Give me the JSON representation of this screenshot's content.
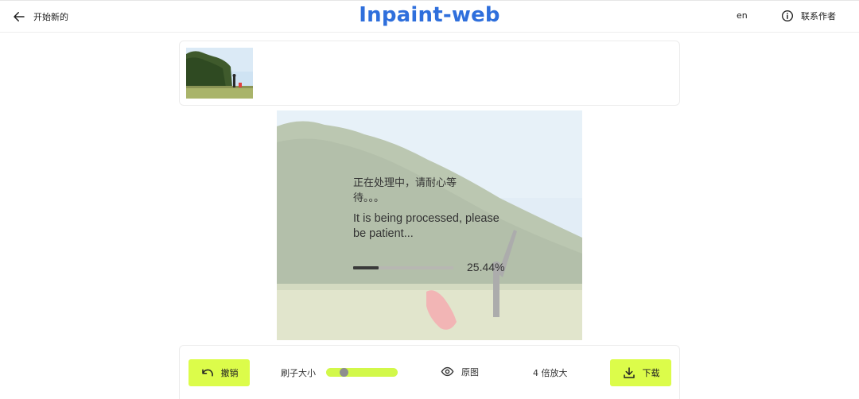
{
  "header": {
    "back_label": "开始新的",
    "title": "Inpaint-web",
    "lang_label": "en",
    "contact_label": "联系作者"
  },
  "icons": {
    "back": "arrow-left-icon",
    "contact": "info-circle-icon",
    "undo": "undo-arrow-icon",
    "original": "eye-icon",
    "download": "download-icon"
  },
  "processing": {
    "message_cn": "正在处理中，请耐心等待。。。",
    "message_en": "It is being processed, please be patient...",
    "progress_value": 0.2544,
    "progress_text": "25.44%"
  },
  "toolbar": {
    "undo_label": "撤销",
    "brush_label": "刷子大小",
    "brush_level": 0.1,
    "original_label": "原图",
    "upscale_label": "4 倍放大",
    "download_label": "下载"
  },
  "colors": {
    "accent_lime": "#dcfc4a",
    "title_blue": "#2f6fdc",
    "progress_fill": "#3a3a3a"
  }
}
